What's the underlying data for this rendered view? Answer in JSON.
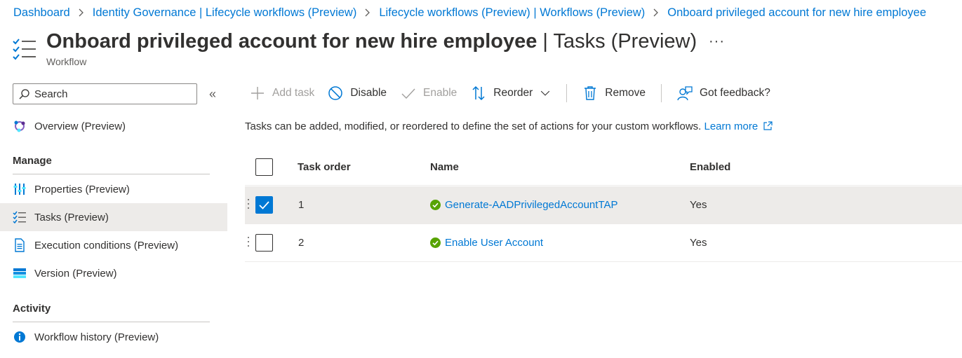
{
  "breadcrumb": {
    "items": [
      "Dashboard",
      "Identity Governance | Lifecycle workflows (Preview)",
      "Lifecycle workflows (Preview) | Workflows (Preview)",
      "Onboard privileged account for new hire employee"
    ]
  },
  "header": {
    "title_main": "Onboard privileged account for new hire employee",
    "title_sub": " | Tasks (Preview)",
    "subtitle": "Workflow",
    "more": "···"
  },
  "sidebar": {
    "search_placeholder": "Search",
    "collapse": "«",
    "overview": "Overview (Preview)",
    "manage_heading": "Manage",
    "manage_items": [
      "Properties (Preview)",
      "Tasks (Preview)",
      "Execution conditions (Preview)",
      "Version (Preview)"
    ],
    "activity_heading": "Activity",
    "activity_items": [
      "Workflow history (Preview)"
    ]
  },
  "toolbar": {
    "add_task": "Add task",
    "disable": "Disable",
    "enable": "Enable",
    "reorder": "Reorder",
    "remove": "Remove",
    "feedback": "Got feedback?"
  },
  "description": {
    "text": "Tasks can be added, modified, or reordered to define the set of actions for your custom workflows. ",
    "learn_more": "Learn more"
  },
  "table": {
    "headers": [
      "Task order",
      "Name",
      "Enabled"
    ],
    "rows": [
      {
        "order": "1",
        "name": "Generate-AADPrivilegedAccountTAP",
        "enabled": "Yes",
        "selected": true
      },
      {
        "order": "2",
        "name": "Enable User Account",
        "enabled": "Yes",
        "selected": false
      }
    ]
  },
  "colors": {
    "accent": "#0078d4",
    "success": "#57a300",
    "selected_row": "#edebe9"
  }
}
